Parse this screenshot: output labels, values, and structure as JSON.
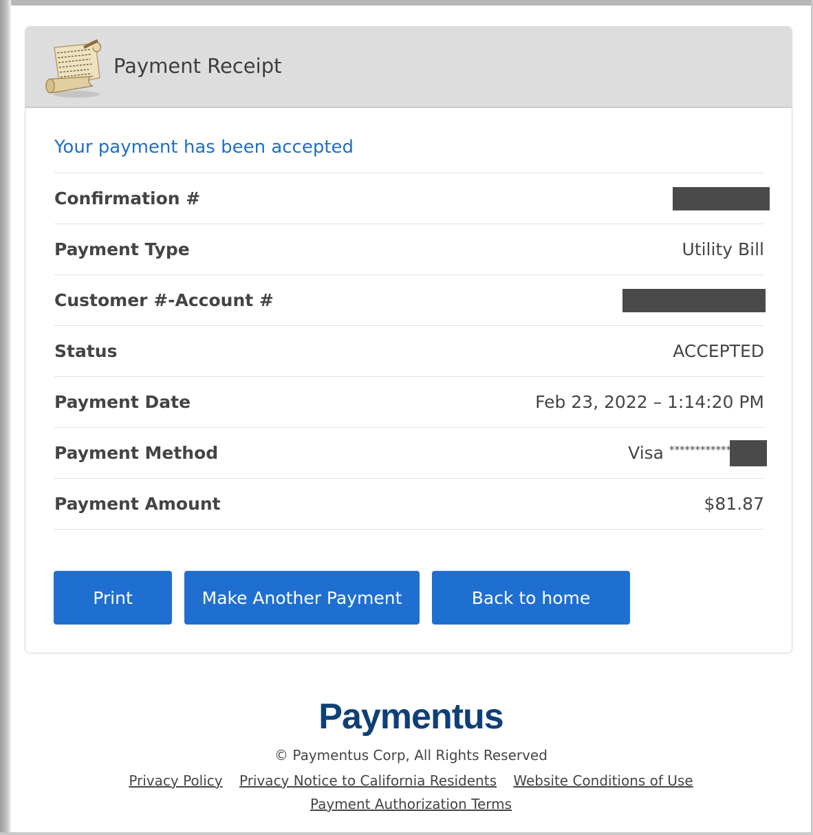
{
  "receipt": {
    "title": "Payment Receipt",
    "accepted_message": "Your payment has been accepted",
    "rows": [
      {
        "label": "Confirmation #",
        "value": "",
        "redacted": true
      },
      {
        "label": "Payment Type",
        "value": "Utility Bill",
        "redacted": false
      },
      {
        "label": "Customer #-Account #",
        "value": "",
        "redacted": true
      },
      {
        "label": "Status",
        "value": "ACCEPTED",
        "redacted": false
      },
      {
        "label": "Payment Date",
        "value": "Feb 23, 2022 – 1:14:20 PM",
        "redacted": false
      },
      {
        "label": "Payment Method",
        "value": "Visa",
        "masked_digits": "************",
        "redacted": true
      },
      {
        "label": "Payment Amount",
        "value": "$81.87",
        "redacted": false
      }
    ]
  },
  "buttons": {
    "print": "Print",
    "make_another": "Make Another Payment",
    "back_home": "Back to home"
  },
  "footer": {
    "brand": "Paymentus",
    "copyright": "© Paymentus Corp, All Rights Reserved",
    "links": [
      "Privacy Policy",
      "Privacy Notice to California Residents",
      "Website Conditions of Use",
      "Payment Authorization Terms"
    ]
  },
  "colors": {
    "accent": "#1f6fd1",
    "message": "#1f6fc5",
    "brand": "#0f3f78",
    "header_bg": "#dddddd",
    "redaction": "#4a4a4a"
  },
  "icons": [
    "scroll-icon"
  ]
}
